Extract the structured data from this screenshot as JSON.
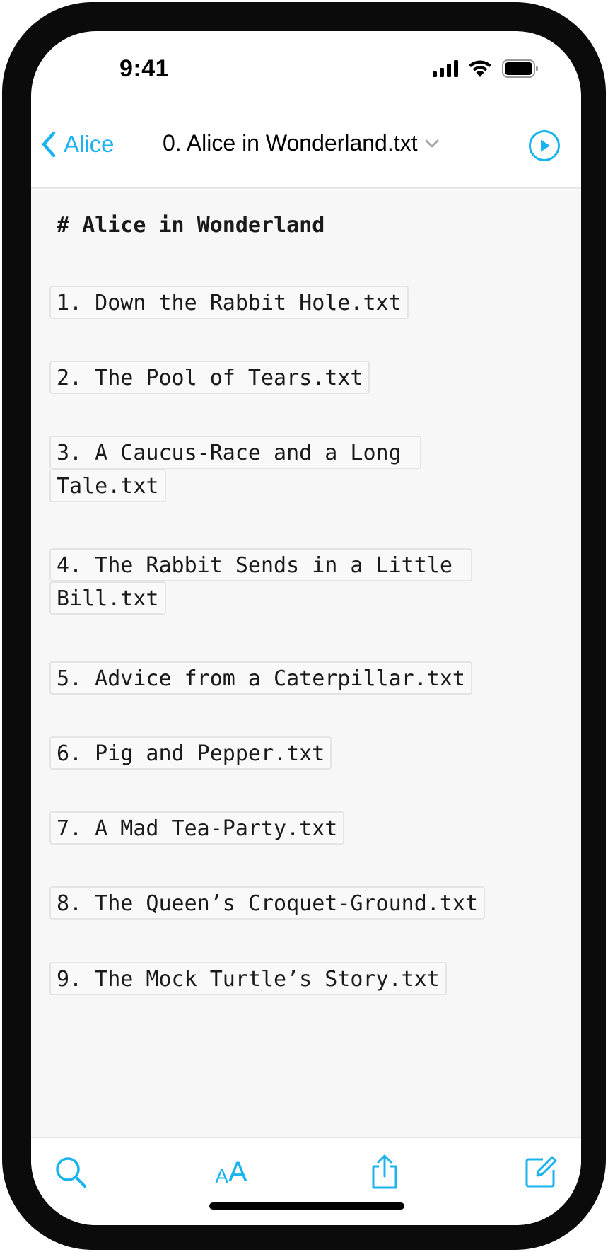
{
  "status_bar": {
    "time": "9:41"
  },
  "nav": {
    "back_label": "Alice",
    "title": "0. Alice in Wonderland.txt"
  },
  "document": {
    "heading": "# Alice in Wonderland",
    "links": [
      {
        "lines": [
          "1. Down the Rabbit Hole.txt"
        ]
      },
      {
        "lines": [
          "2. The Pool of Tears.txt"
        ]
      },
      {
        "lines": [
          "3. A Caucus-Race and a Long ",
          "Tale.txt"
        ]
      },
      {
        "lines": [
          "4. The Rabbit Sends in a Little ",
          "Bill.txt"
        ]
      },
      {
        "lines": [
          "5. Advice from a Caterpillar.txt"
        ]
      },
      {
        "lines": [
          "6. Pig and Pepper.txt"
        ]
      },
      {
        "lines": [
          "7. A Mad Tea-Party.txt"
        ]
      },
      {
        "lines": [
          "8. The Queen’s Croquet-Ground.txt"
        ]
      },
      {
        "lines": [
          "9. The Mock Turtle’s Story.txt"
        ]
      }
    ]
  },
  "toolbar": {
    "text_size_small": "A",
    "text_size_large": "A",
    "icons": [
      "search-icon",
      "text-size-icon",
      "share-icon",
      "compose-icon"
    ]
  },
  "colors": {
    "accent": "#1ab3f0",
    "content_background": "#f7f7f7",
    "text": "#1a1a1a"
  }
}
